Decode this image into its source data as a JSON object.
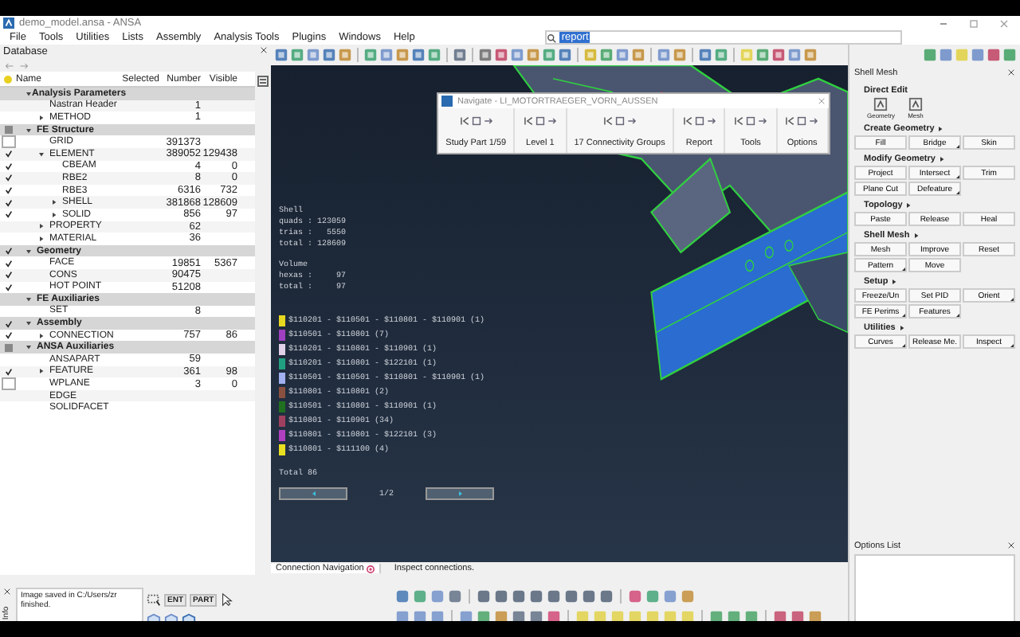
{
  "window": {
    "title": "demo_model.ansa - ANSA"
  },
  "menu": [
    "File",
    "Tools",
    "Utilities",
    "Lists",
    "Assembly",
    "Analysis Tools",
    "Plugins",
    "Windows",
    "Help"
  ],
  "search": {
    "value": "report"
  },
  "database": {
    "title": "Database",
    "columns": [
      "Name",
      "Selected",
      "Number",
      "Visible"
    ],
    "tree": [
      {
        "name": "Analysis Parameters",
        "kind": "category",
        "expanded": true,
        "children": [
          {
            "name": "Nastran Header",
            "number": "1"
          },
          {
            "name": "METHOD",
            "expanded": false,
            "number": "1"
          }
        ]
      },
      {
        "name": "FE Structure",
        "kind": "category",
        "checked": false,
        "partial": true,
        "expanded": true,
        "children": [
          {
            "name": "GRID",
            "checked": false,
            "number": "391373"
          },
          {
            "name": "ELEMENT",
            "checked": true,
            "expanded": true,
            "number": "389052",
            "visible": "129438",
            "children": [
              {
                "name": "CBEAM",
                "checked": true,
                "number": "4",
                "visible": "0"
              },
              {
                "name": "RBE2",
                "checked": true,
                "number": "8",
                "visible": "0"
              },
              {
                "name": "RBE3",
                "checked": true,
                "number": "6316",
                "visible": "732"
              },
              {
                "name": "SHELL",
                "checked": true,
                "expanded": false,
                "number": "381868",
                "visible": "128609"
              },
              {
                "name": "SOLID",
                "checked": true,
                "expanded": false,
                "number": "856",
                "visible": "97"
              }
            ]
          },
          {
            "name": "PROPERTY",
            "expanded": false,
            "number": "62"
          },
          {
            "name": "MATERIAL",
            "expanded": false,
            "number": "36"
          }
        ]
      },
      {
        "name": "Geometry",
        "kind": "category",
        "checked": true,
        "expanded": true,
        "children": [
          {
            "name": "FACE",
            "checked": true,
            "number": "19851",
            "visible": "5367"
          },
          {
            "name": "CONS",
            "checked": true,
            "number": "90475"
          },
          {
            "name": "HOT POINT",
            "checked": true,
            "number": "51208"
          }
        ]
      },
      {
        "name": "FE Auxiliaries",
        "kind": "category",
        "expanded": true,
        "children": [
          {
            "name": "SET",
            "number": "8"
          }
        ]
      },
      {
        "name": "Assembly",
        "kind": "category",
        "checked": true,
        "expanded": true,
        "children": [
          {
            "name": "CONNECTION",
            "checked": true,
            "expanded": false,
            "number": "757",
            "visible": "86"
          }
        ]
      },
      {
        "name": "ANSA Auxiliaries",
        "kind": "category",
        "checked": false,
        "partial": true,
        "expanded": true,
        "children": [
          {
            "name": "ANSAPART",
            "number": "59"
          },
          {
            "name": "FEATURE",
            "checked": true,
            "expanded": false,
            "number": "361",
            "visible": "98"
          },
          {
            "name": "WPLANE",
            "checked": false,
            "number": "3",
            "visible": "0"
          },
          {
            "name": "EDGE"
          },
          {
            "name": "SOLIDFACET"
          }
        ]
      }
    ]
  },
  "viewport": {
    "stats": [
      [
        "Shell",
        "quads : 123059",
        "trias :   5550",
        "total : 128609"
      ],
      [
        "Volume",
        "hexas :     97",
        "total :     97"
      ]
    ],
    "legend": [
      {
        "label": "$110201 - $110501 - $110801 - $110901 (1)",
        "color": "#e8d820"
      },
      {
        "label": "$110501 - $110801 (7)",
        "color": "#a040c0"
      },
      {
        "label": "$110201 - $110801 - $110901 (1)",
        "color": "#e0d0e8"
      },
      {
        "label": "$110201 - $110801 - $122101 (1)",
        "color": "#20a080"
      },
      {
        "label": "$110501 - $110501 - $110801 - $110901 (1)",
        "color": "#a0b0f0"
      },
      {
        "label": "$110801 - $110801 (2)",
        "color": "#8a5040"
      },
      {
        "label": "$110501 - $110801 - $110901 (1)",
        "color": "#207020"
      },
      {
        "label": "$110801 - $110901 (34)",
        "color": "#a04060"
      },
      {
        "label": "$110801 - $110801 - $122101 (3)",
        "color": "#b040c0"
      },
      {
        "label": "$110801 - $111100 (4)",
        "color": "#e8e020"
      }
    ],
    "total": "Total 86",
    "page": "1/2"
  },
  "navigator": {
    "title": "Navigate - LI_MOTORTRAEGER_VORN_AUSSEN",
    "groups": [
      "Study Part 1/59",
      "Level 1",
      "17 Connectivity Groups",
      "Report",
      "Tools",
      "Options"
    ]
  },
  "shell_mesh": {
    "title": "Shell Mesh",
    "direct_edit": {
      "title": "Direct Edit",
      "items": [
        "Geometry",
        "Mesh"
      ]
    },
    "sections": [
      {
        "title": "Create Geometry",
        "more": true,
        "buttons": [
          {
            "label": "Fill",
            "dropdown": false
          },
          {
            "label": "Bridge",
            "dropdown": true
          },
          {
            "label": "Skin",
            "dropdown": false
          }
        ]
      },
      {
        "title": "Modify Geometry",
        "more": true,
        "buttons": [
          {
            "label": "Project",
            "dropdown": false
          },
          {
            "label": "Intersect",
            "dropdown": true
          },
          {
            "label": "Trim",
            "dropdown": false
          },
          {
            "label": "Plane Cut",
            "dropdown": false
          },
          {
            "label": "Defeature",
            "dropdown": true
          }
        ]
      },
      {
        "title": "Topology",
        "more": true,
        "buttons": [
          {
            "label": "Paste",
            "dropdown": false
          },
          {
            "label": "Release",
            "dropdown": false
          },
          {
            "label": "Heal",
            "dropdown": false
          }
        ]
      },
      {
        "title": "Shell Mesh",
        "more": true,
        "buttons": [
          {
            "label": "Mesh",
            "dropdown": false
          },
          {
            "label": "Improve",
            "dropdown": false
          },
          {
            "label": "Reset",
            "dropdown": false
          },
          {
            "label": "Pattern",
            "dropdown": true
          },
          {
            "label": "Move",
            "dropdown": false
          }
        ]
      },
      {
        "title": "Setup",
        "more": true,
        "buttons": [
          {
            "label": "Freeze/Un",
            "dropdown": false
          },
          {
            "label": "Set PID",
            "dropdown": false
          },
          {
            "label": "Orient",
            "dropdown": true
          },
          {
            "label": "FE Perims",
            "dropdown": true
          },
          {
            "label": "Features",
            "dropdown": true
          }
        ]
      },
      {
        "title": "Utilities",
        "more": true,
        "buttons": [
          {
            "label": "Curves",
            "dropdown": true
          },
          {
            "label": "Release Me.",
            "dropdown": false
          },
          {
            "label": "Inspect",
            "dropdown": true
          }
        ]
      }
    ]
  },
  "options_list": {
    "title": "Options List"
  },
  "info": {
    "lines": [
      "Image saved in C:/Users/zr",
      "finished."
    ],
    "tab": "Info"
  },
  "connection_tab": {
    "title": "Connection Navigation",
    "hint": "Inspect connections."
  },
  "select_tools": [
    "ENT",
    "PART"
  ]
}
